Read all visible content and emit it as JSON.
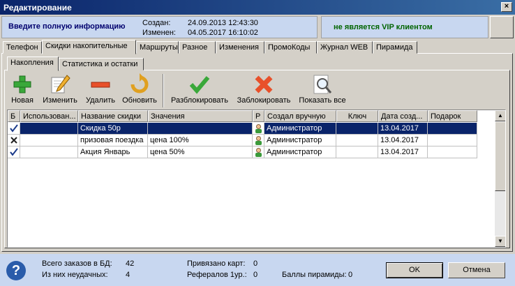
{
  "window": {
    "title": "Редактирование",
    "close_glyph": "×"
  },
  "header": {
    "prompt": "Введите полную информацию",
    "created_label": "Создан:",
    "created_value": "24.09.2013 12:43:30",
    "modified_label": "Изменен:",
    "modified_value": "04.05.2017 16:10:02",
    "vip_status": "не является VIP клиентом"
  },
  "tabs": [
    "Телефон",
    "Скидки накопительные",
    "Маршруты",
    "Разное",
    "Изменения",
    "ПромоКоды",
    "Журнал WEB",
    "Пирамида"
  ],
  "subtabs": [
    "Накопления",
    "Статистика и остатки"
  ],
  "toolbar": {
    "new": "Новая",
    "edit": "Изменить",
    "delete": "Удалить",
    "refresh": "Обновить",
    "unblock": "Разблокировать",
    "block": "Заблокировать",
    "show_all": "Показать все"
  },
  "grid": {
    "columns": [
      "Б",
      "Использован...",
      "Название скидки",
      "Значения",
      "Р",
      "Создал вручную",
      "Ключ",
      "Дата созд...",
      "Подарок"
    ],
    "rows": [
      {
        "b": "check",
        "used": "",
        "name": "Скидка 50р",
        "value": "",
        "r": "user",
        "creator": "Администратор",
        "key": "",
        "date": "13.04.2017",
        "gift": ""
      },
      {
        "b": "cross",
        "used": "",
        "name": "призовая поездка",
        "value": "цена 100%",
        "r": "user",
        "creator": "Администратор",
        "key": "",
        "date": "13.04.2017",
        "gift": ""
      },
      {
        "b": "check",
        "used": "",
        "name": "Акция Январь",
        "value": "цена 50%",
        "r": "user",
        "creator": "Администратор",
        "key": "",
        "date": "13.04.2017",
        "gift": ""
      }
    ]
  },
  "footer": {
    "total_orders_label": "Всего заказов в БД:",
    "total_orders_value": "42",
    "failed_label": "Из них неудачных:",
    "failed_value": "4",
    "cards_label": "Привязано карт:",
    "cards_value": "0",
    "referrals_label": "Рефералов 1ур.:",
    "referrals_value": "0",
    "pyramid_label": "Баллы пирамиды:",
    "pyramid_value": "0",
    "ok": "OK",
    "cancel": "Отмена"
  },
  "colors": {
    "accent": "#0a246a",
    "vip": "#006400",
    "panel": "#c8d7f0"
  }
}
